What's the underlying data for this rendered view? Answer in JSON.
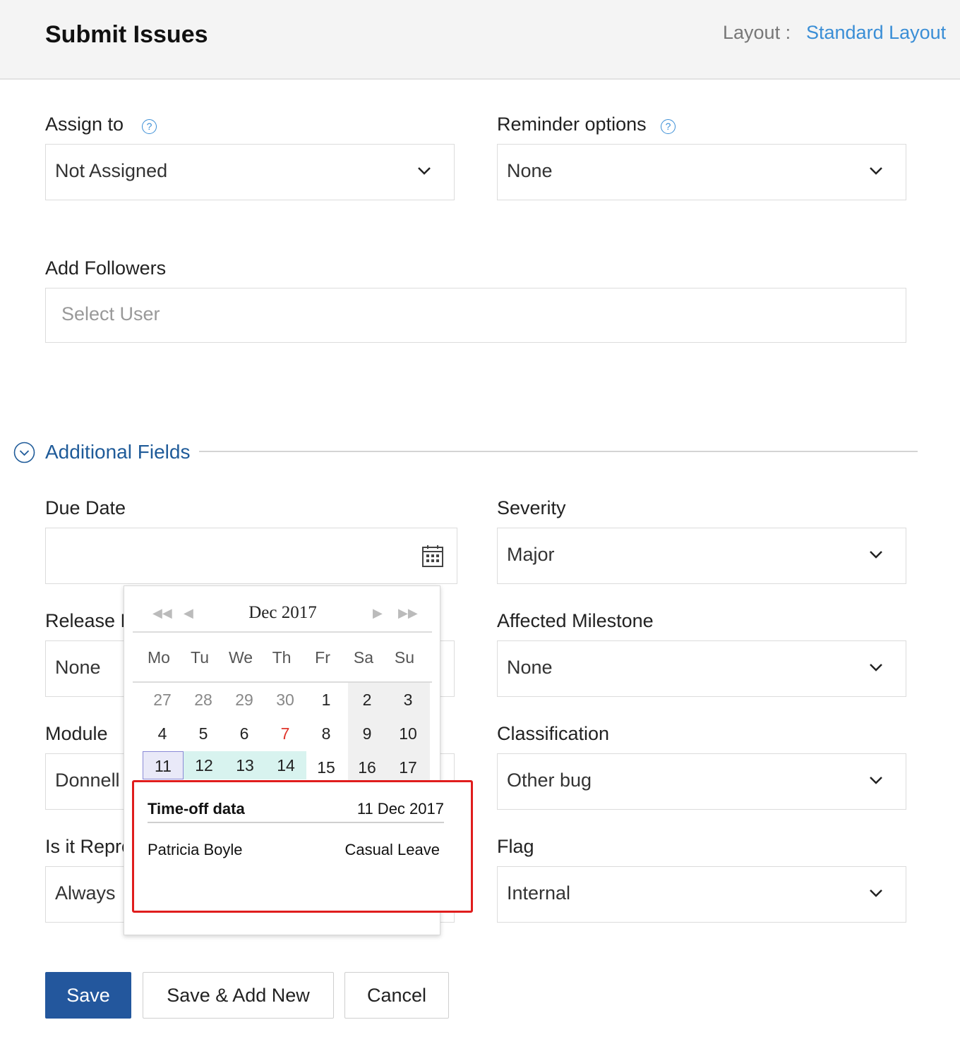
{
  "header": {
    "title": "Submit Issues",
    "layout_label": "Layout :",
    "layout_value": "Standard Layout"
  },
  "fields": {
    "assign_to": {
      "label": "Assign to",
      "value": "Not Assigned"
    },
    "reminder": {
      "label": "Reminder options",
      "value": "None"
    },
    "followers": {
      "label": "Add Followers",
      "placeholder": "Select User"
    },
    "due_date": {
      "label": "Due Date",
      "value": ""
    },
    "severity": {
      "label": "Severity",
      "value": "Major"
    },
    "release": {
      "label": "Release M",
      "value": "None"
    },
    "affected_milestone": {
      "label": "Affected Milestone",
      "value": "None"
    },
    "module": {
      "label": "Module",
      "value": "Donnell"
    },
    "classification": {
      "label": "Classification",
      "value": "Other bug"
    },
    "reproducible": {
      "label": "Is it Repro",
      "value": "Always"
    },
    "flag": {
      "label": "Flag",
      "value": "Internal"
    }
  },
  "section": {
    "title": "Additional Fields"
  },
  "datepicker": {
    "month_label": "Dec 2017",
    "weekdays": [
      "Mo",
      "Tu",
      "We",
      "Th",
      "Fr",
      "Sa",
      "Su"
    ],
    "rows": [
      [
        "27",
        "28",
        "29",
        "30",
        "1",
        "2",
        "3"
      ],
      [
        "4",
        "5",
        "6",
        "7",
        "8",
        "9",
        "10"
      ],
      [
        "11",
        "12",
        "13",
        "14",
        "15",
        "16",
        "17"
      ]
    ],
    "highlighted_holiday": "7",
    "today": "11",
    "leave_days": [
      "12",
      "13",
      "14"
    ]
  },
  "tooltip": {
    "title": "Time-off data",
    "date": "11 Dec 2017",
    "person": "Patricia Boyle",
    "leave_type": "Casual Leave"
  },
  "buttons": {
    "save": "Save",
    "save_add_new": "Save & Add New",
    "cancel": "Cancel"
  },
  "colors": {
    "accent": "#3a8ed6",
    "section_title": "#1f5b99",
    "primary_button": "#23579d",
    "leave_highlight": "#d8f3ef",
    "holiday_text": "#e0362c",
    "tooltip_border": "#e01d1d"
  }
}
